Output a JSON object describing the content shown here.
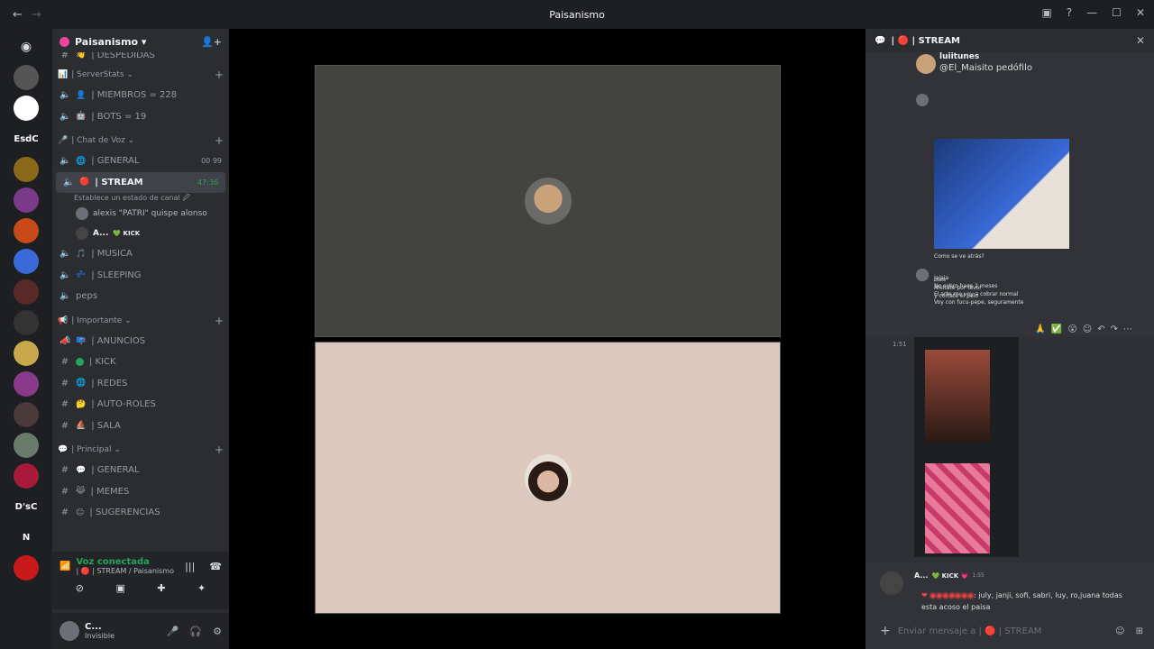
{
  "titlebar": {
    "title": "Paisanismo",
    "back": "←",
    "forward": "→"
  },
  "server": {
    "name": "Paisanismo ▾"
  },
  "guild_labels": {
    "esdc": "EsdC",
    "dsc": "D'sC",
    "n": "N"
  },
  "channels": {
    "top_item": "| DESPEDIDAS",
    "serverstats_cat": "| ServerStats ⌄",
    "miembros": "| MIEMBROS = 228",
    "bots": "| BOTS = 19",
    "voz_cat": "| Chat de Voz ⌄",
    "general_voice": "| GENERAL",
    "general_voice_meta": "00  99",
    "stream": "| STREAM",
    "stream_time": "47:36",
    "stream_status": "Establece un estado de canal 🖉",
    "stream_user1": "alexis \"PATRI\" quispe alonso",
    "stream_user2": "A...",
    "stream_user2_badge": "💚 KICK",
    "musica": "| MUSICA",
    "sleeping": "| SLEEPING",
    "peps": "peps",
    "importante_cat": "| Importante ⌄",
    "anuncios": "| ANUNCIOS",
    "kick": "| KICK",
    "redes": "| REDES",
    "autoroles": "| AUTO-ROLES",
    "sala": "| SALA",
    "principal_cat": "| Principal ⌄",
    "general_text": "| GENERAL",
    "memes": "| MEMES",
    "sugerencias": "| SUGERENCIAS"
  },
  "voice": {
    "status": "Voz conectada",
    "location": "| 🔴 | STREAM / Paisanismo"
  },
  "user": {
    "name": "C...",
    "status": "Invisible"
  },
  "chat": {
    "title": "| 🔴 | STREAM",
    "msg1_user": "luiitunes",
    "msg1_text": "@El_Maisito pedófilo",
    "img_caption": "Como se ve atrás?",
    "msg_lines": [
      "bien",
      "Afeitate por favor",
      "y cortate el pelo"
    ],
    "msg_lines2": [
      "Jajaja",
      "No cobro hace 2 meses",
      "El arte me voy a cobrar normal",
      "Voy con fucu-pepe, seguramente"
    ],
    "time1": "1:51",
    "last_user": "A...",
    "last_badge": "💚 KICK 💗",
    "last_time": "1:55",
    "last_text1": ": july, janji, sofi, sabri, luy, ro,juana todas",
    "last_text2": "esta acoso el paisa",
    "input_placeholder": "Enviar mensaje a | 🔴 | STREAM"
  },
  "colors": {
    "green": "#23a55a",
    "accent": "#5865f2",
    "red": "#ed4245"
  }
}
